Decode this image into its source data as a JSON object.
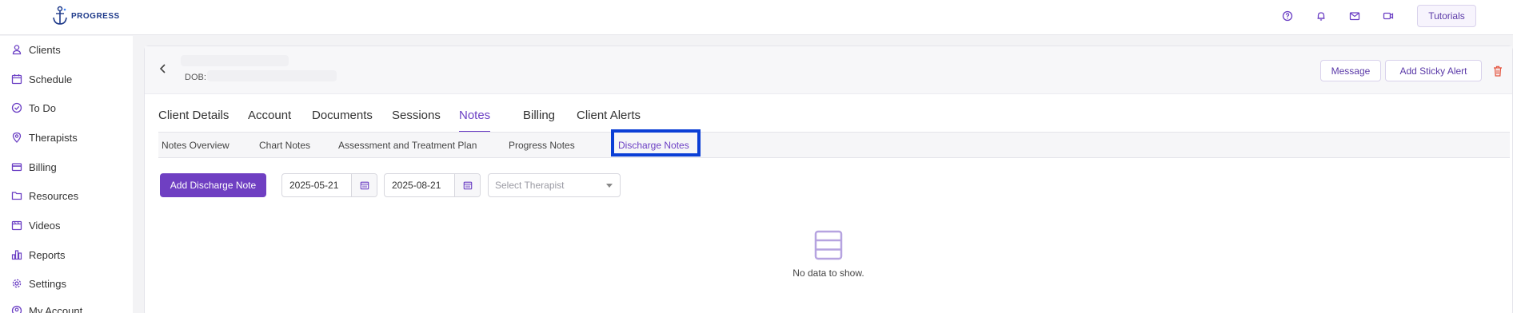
{
  "app": {
    "logo_text": "PROGRESS"
  },
  "topbar": {
    "icons": [
      "help-icon",
      "bell-icon",
      "mail-icon",
      "video-icon"
    ],
    "tutorials_label": "Tutorials"
  },
  "sidebar": {
    "items": [
      {
        "label": "Clients",
        "icon": "user-icon",
        "active": true
      },
      {
        "label": "Schedule",
        "icon": "calendar-icon"
      },
      {
        "label": "To Do",
        "icon": "check-circle-icon"
      },
      {
        "label": "Therapists",
        "icon": "location-pin-icon"
      },
      {
        "label": "Billing",
        "icon": "credit-card-icon"
      },
      {
        "label": "Resources",
        "icon": "folder-icon"
      },
      {
        "label": "Videos",
        "icon": "video-calendar-icon"
      },
      {
        "label": "Reports",
        "icon": "bar-chart-icon"
      },
      {
        "label": "Settings",
        "icon": "gear-icon"
      },
      {
        "label": "My Account",
        "icon": "account-icon"
      }
    ]
  },
  "client": {
    "dob_label": "DOB:"
  },
  "header_actions": {
    "message_label": "Message",
    "sticky_alert_label": "Add Sticky Alert"
  },
  "tabs": [
    {
      "label": "Client Details"
    },
    {
      "label": "Account"
    },
    {
      "label": "Documents"
    },
    {
      "label": "Sessions"
    },
    {
      "label": "Notes",
      "active": true
    },
    {
      "label": "Billing"
    },
    {
      "label": "Client Alerts"
    }
  ],
  "subtabs": [
    {
      "label": "Notes Overview"
    },
    {
      "label": "Chart Notes"
    },
    {
      "label": "Assessment and Treatment Plan"
    },
    {
      "label": "Progress Notes"
    },
    {
      "label": "Discharge Notes",
      "active": true
    }
  ],
  "toolbar": {
    "add_label": "Add Discharge Note",
    "start_date": "2025-05-21",
    "end_date": "2025-08-21",
    "therapist_placeholder": "Select Therapist"
  },
  "empty_state": {
    "message": "No data to show."
  },
  "colors": {
    "accent": "#6b3fc4",
    "highlight": "#0b3fd6",
    "danger": "#e5533d"
  }
}
